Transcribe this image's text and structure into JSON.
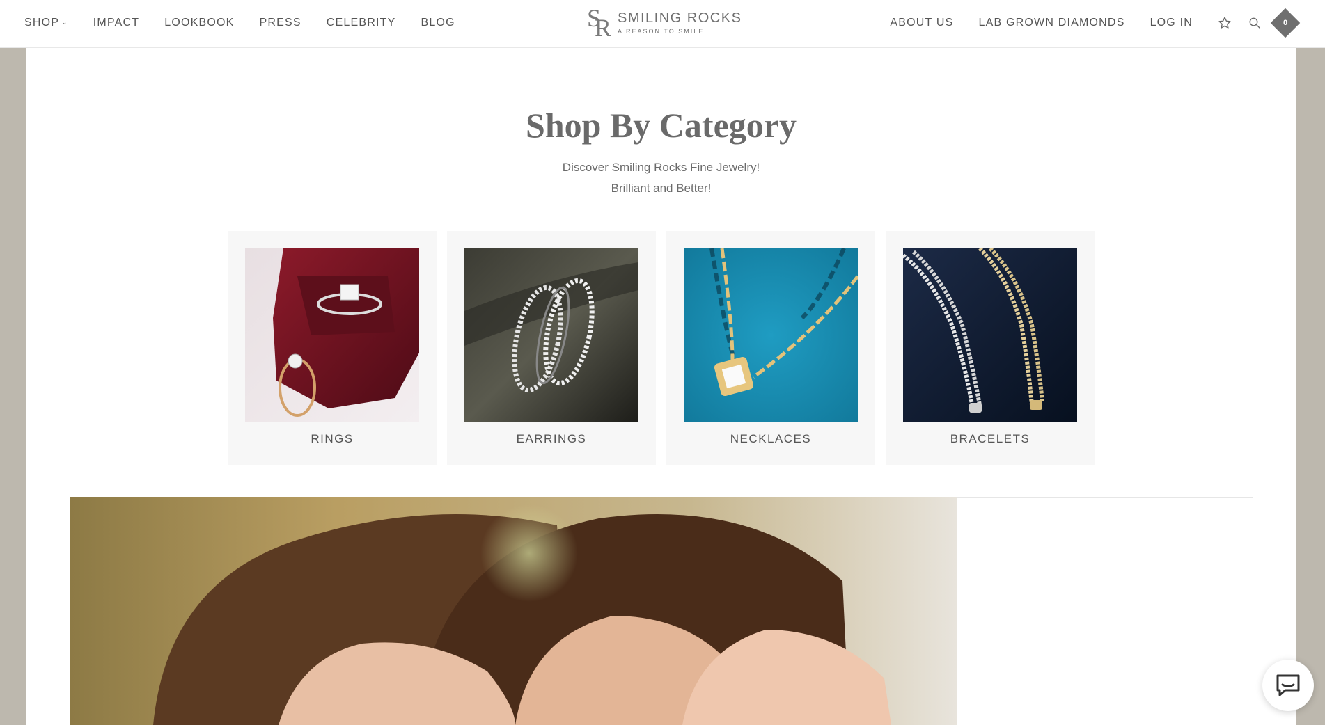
{
  "header": {
    "nav_left": [
      {
        "label": "SHOP",
        "has_dropdown": true
      },
      {
        "label": "IMPACT"
      },
      {
        "label": "LOOKBOOK"
      },
      {
        "label": "PRESS"
      },
      {
        "label": "CELEBRITY"
      },
      {
        "label": "BLOG"
      }
    ],
    "logo": {
      "name": "SMILING ROCKS",
      "tagline": "A REASON TO SMILE"
    },
    "nav_right": [
      {
        "label": "ABOUT US"
      },
      {
        "label": "LAB GROWN DIAMONDS"
      },
      {
        "label": "LOG IN"
      }
    ],
    "icons": [
      "star-icon",
      "search-icon",
      "cart-icon"
    ],
    "cart_count": "0"
  },
  "category_section": {
    "title": "Shop By Category",
    "subtitle_line1": "Discover Smiling Rocks Fine Jewelry!",
    "subtitle_line2": "Brilliant and Better!",
    "categories": [
      {
        "label": "RINGS"
      },
      {
        "label": "EARRINGS"
      },
      {
        "label": "NECKLACES"
      },
      {
        "label": "BRACELETS"
      }
    ]
  },
  "colors": {
    "page_bg": "#bdb8ae",
    "text": "#555555",
    "card_bg": "#f7f7f7"
  }
}
